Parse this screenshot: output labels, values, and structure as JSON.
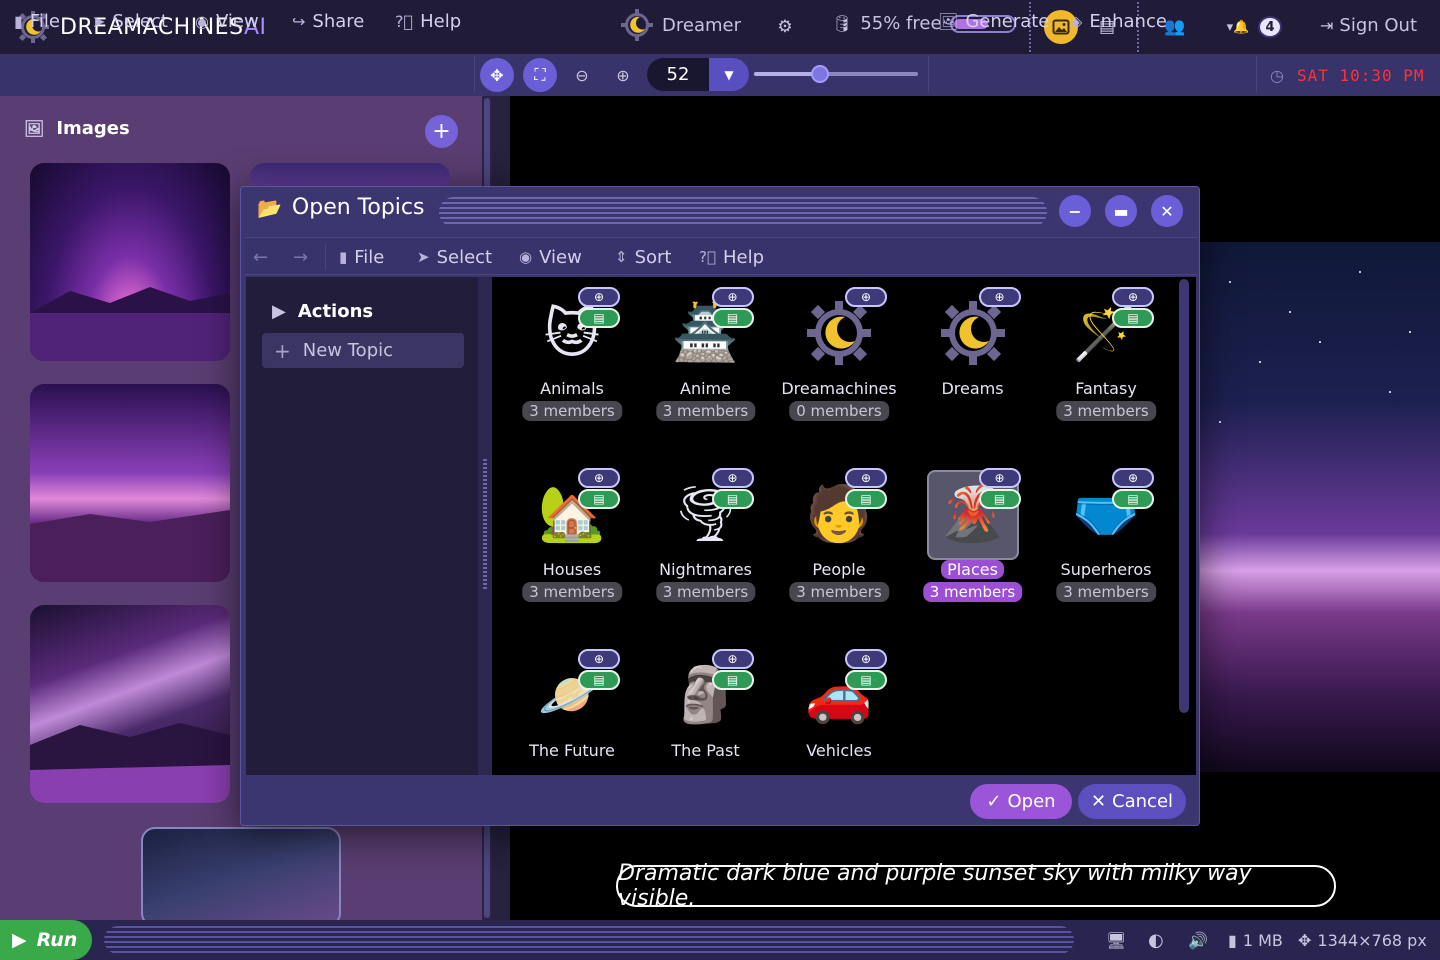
{
  "brand": {
    "name": "DREAMACHINES",
    "suffix": "AI"
  },
  "header": {
    "user": "Dreamer",
    "storage": "55% free",
    "storage_fraction": 0.55,
    "notification_count": "4",
    "sign_out": "Sign Out"
  },
  "menu": {
    "file": "File",
    "select": "Select",
    "view": "View",
    "share": "Share",
    "help": "Help",
    "zoom_value": "52",
    "zoom_slider_fraction": 0.4,
    "generate": "Generate",
    "enhance": "Enhance",
    "clock": "SAT 10:30 PM"
  },
  "gallery": {
    "title": "Images"
  },
  "preview": {
    "caption": "Dramatic dark blue and purple sunset sky with milky way visible."
  },
  "dialog": {
    "title": "Open Topics",
    "toolbar": {
      "file": "File",
      "select": "Select",
      "view": "View",
      "sort": "Sort",
      "help": "Help"
    },
    "sidebar": {
      "heading": "Actions",
      "new_topic": "New Topic"
    },
    "topics": [
      {
        "name": "Animals",
        "count": "3 members",
        "icon": "cat-face",
        "glyph": "🐱",
        "grid_pill": true
      },
      {
        "name": "Anime",
        "count": "3 members",
        "icon": "japanese-castle",
        "glyph": "🏯",
        "grid_pill": true
      },
      {
        "name": "Dreamachines",
        "count": "0 members",
        "icon": "dreamachines-logo",
        "glyph": "",
        "grid_pill": false
      },
      {
        "name": "Dreams",
        "count": "",
        "icon": "dreamachines-logo",
        "glyph": "",
        "grid_pill": false
      },
      {
        "name": "Fantasy",
        "count": "3 members",
        "icon": "magic-wand",
        "glyph": "🪄",
        "grid_pill": true
      },
      {
        "name": "Houses",
        "count": "3 members",
        "icon": "house-with-garden",
        "glyph": "🏡",
        "grid_pill": true
      },
      {
        "name": "Nightmares",
        "count": "3 members",
        "icon": "tornado",
        "glyph": "🌪",
        "grid_pill": true
      },
      {
        "name": "People",
        "count": "3 members",
        "icon": "person-face",
        "glyph": "🧑",
        "grid_pill": true
      },
      {
        "name": "Places",
        "count": "3 members",
        "icon": "volcano",
        "glyph": "🌋",
        "grid_pill": true,
        "selected": true
      },
      {
        "name": "Superheros",
        "count": "3 members",
        "icon": "briefs",
        "glyph": "🩲",
        "grid_pill": true
      },
      {
        "name": "The Future",
        "count": "",
        "icon": "ringed-planet",
        "glyph": "🪐",
        "grid_pill": true
      },
      {
        "name": "The Past",
        "count": "",
        "icon": "moai",
        "glyph": "🗿",
        "grid_pill": true
      },
      {
        "name": "Vehicles",
        "count": "",
        "icon": "red-car",
        "glyph": "🚗",
        "grid_pill": true
      }
    ],
    "open": "Open",
    "cancel": "Cancel"
  },
  "footer": {
    "run": "Run",
    "file_size": "1 MB",
    "dimensions": "1344×768 px"
  },
  "colors": {
    "accent": "#6a5fd6",
    "selected": "#9b4fd4",
    "run": "#3aa94a",
    "clock": "#ff3333",
    "brand_ai": "#a88bff"
  }
}
